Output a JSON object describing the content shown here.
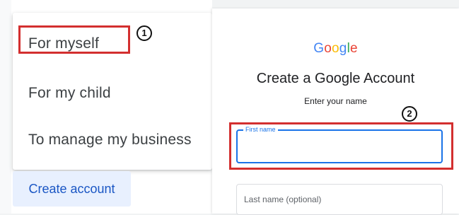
{
  "account_type_menu": {
    "items": [
      {
        "label": "For myself"
      },
      {
        "label": "For my child"
      },
      {
        "label": "To manage my business"
      }
    ],
    "step_marker": "1"
  },
  "create_account_button": {
    "label": "Create account"
  },
  "signup_form": {
    "logo_text": "Google",
    "logo_colors": [
      "#4285F4",
      "#EA4335",
      "#FBBC05",
      "#4285F4",
      "#34A853",
      "#EA4335"
    ],
    "title": "Create a Google Account",
    "subtitle": "Enter your name",
    "first_name_label": "First name",
    "last_name_placeholder": "Last name (optional)",
    "step_marker": "2"
  },
  "annotation_color": "#d32f2f",
  "focus_color": "#1a73e8"
}
